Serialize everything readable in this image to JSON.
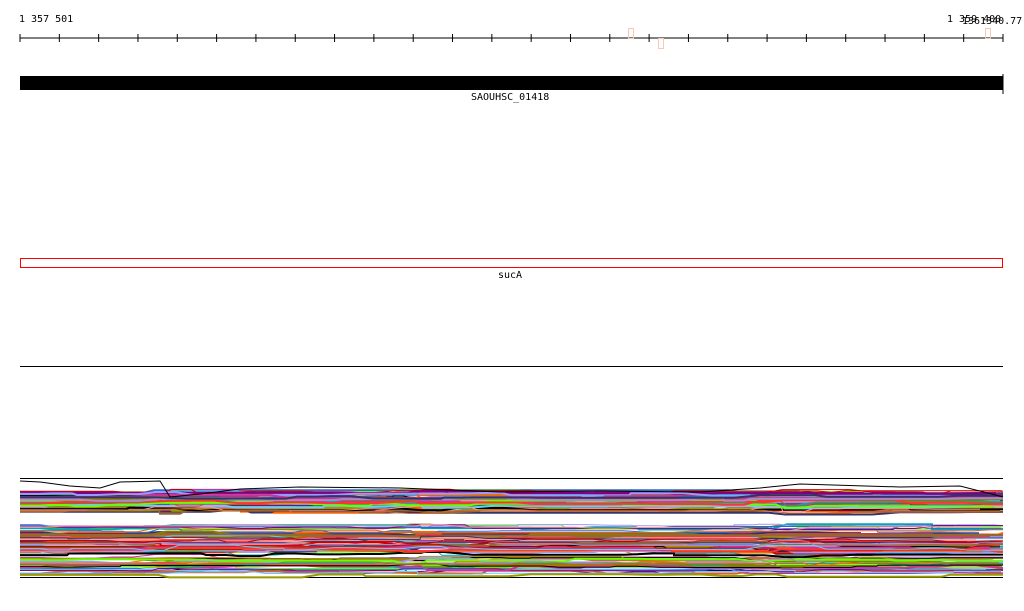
{
  "ruler": {
    "start_label": "1 357 501",
    "end_label": "1 359 400",
    "cursor_label": "1361340.77",
    "tick_count": 25
  },
  "features": [
    {
      "name": "SAOUHSC_01418",
      "style": "filled",
      "color": "#000000"
    },
    {
      "name": "sucA",
      "style": "outline",
      "color": "#ff0000"
    }
  ],
  "markers_color": "#f5c8b8",
  "track_colors": [
    "#000000",
    "#ff6600",
    "#3366cc",
    "#cc0000",
    "#800080",
    "#808000",
    "#66ccff",
    "#ff9999",
    "#9999ff",
    "#996633",
    "#66ff00",
    "#cc3399",
    "#ff3333",
    "#aa88cc",
    "#333366",
    "#cc6633",
    "#999900",
    "#00aaaa"
  ]
}
